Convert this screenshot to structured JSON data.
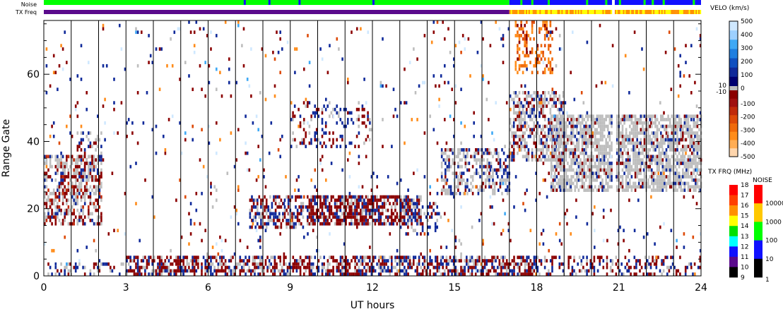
{
  "chart_data": {
    "type": "heatmap",
    "xlabel": "UT hours",
    "ylabel": "Range Gate",
    "xlim": [
      0,
      24
    ],
    "ylim": [
      0,
      76
    ],
    "xticks": [
      "0",
      "3",
      "6",
      "9",
      "12",
      "15",
      "18",
      "21",
      "24"
    ],
    "yticks": [
      "0",
      "20",
      "40",
      "60"
    ],
    "ground_scatter_color": "#bebebe",
    "data_gap_hours": [
      20.75,
      20.85
    ],
    "echo_regions": [
      {
        "t": [
          0,
          2.1
        ],
        "g": [
          15,
          36
        ],
        "density": 0.55,
        "mix": {
          "gs": 0.5,
          "-50": 0.3,
          "50": 0.1,
          "-150": 0.1
        }
      },
      {
        "t": [
          1.2,
          2.1
        ],
        "g": [
          28,
          43
        ],
        "density": 0.4,
        "mix": {
          "gs": 0.5,
          "-50": 0.3,
          "50": 0.2
        }
      },
      {
        "t": [
          0,
          3
        ],
        "g": [
          0,
          4
        ],
        "density": 0.25,
        "mix": {
          "50": 0.4,
          "-50": 0.3,
          "gs": 0.3
        }
      },
      {
        "t": [
          3,
          18
        ],
        "g": [
          0,
          6
        ],
        "density": 0.6,
        "mix": {
          "-50": 0.5,
          "50": 0.3,
          "gs": 0.2
        }
      },
      {
        "t": [
          18,
          24
        ],
        "g": [
          0,
          6
        ],
        "density": 0.3,
        "mix": {
          "-50": 0.45,
          "50": 0.35,
          "gs": 0.2
        }
      },
      {
        "t": [
          7.5,
          9.5
        ],
        "g": [
          14,
          24
        ],
        "density": 0.55,
        "mix": {
          "-50": 0.45,
          "50": 0.35,
          "gs": 0.2
        }
      },
      {
        "t": [
          9.6,
          13.8
        ],
        "g": [
          15,
          24
        ],
        "density": 0.75,
        "mix": {
          "-50": 0.65,
          "50": 0.2,
          "gs": 0.15
        }
      },
      {
        "t": [
          13,
          14.5
        ],
        "g": [
          12,
          22
        ],
        "density": 0.3,
        "mix": {
          "50": 0.5,
          "-50": 0.3,
          "gs": 0.2
        }
      },
      {
        "t": [
          9,
          12
        ],
        "g": [
          38,
          52
        ],
        "density": 0.18,
        "mix": {
          "-50": 0.4,
          "50": 0.4,
          "gs": 0.2
        }
      },
      {
        "t": [
          14.5,
          17
        ],
        "g": [
          24,
          38
        ],
        "density": 0.5,
        "mix": {
          "gs": 0.55,
          "50": 0.3,
          "-50": 0.15
        }
      },
      {
        "t": [
          17,
          19
        ],
        "g": [
          34,
          55
        ],
        "density": 0.55,
        "mix": {
          "gs": 0.6,
          "50": 0.2,
          "-50": 0.2
        }
      },
      {
        "t": [
          18.5,
          24
        ],
        "g": [
          25,
          48
        ],
        "density": 0.7,
        "mix": {
          "gs": 0.8,
          "50": 0.1,
          "-50": 0.1
        }
      },
      {
        "t": [
          17.2,
          18.6
        ],
        "g": [
          60,
          76
        ],
        "density": 0.35,
        "mix": {
          "-350": 0.4,
          "-450": 0.3,
          "-250": 0.2,
          "-50": 0.1
        }
      },
      {
        "t": [
          0,
          24
        ],
        "g": [
          0,
          76
        ],
        "density": 0.025,
        "mix": {
          "-50": 0.3,
          "50": 0.3,
          "-450": 0.12,
          "450": 0.12,
          "gs": 0.08,
          "250": 0.04,
          "-250": 0.04
        }
      }
    ],
    "noise_bar": [
      {
        "t": [
          0,
          17
        ],
        "level": "100"
      },
      {
        "t": [
          17,
          20.75
        ],
        "level": "10"
      },
      {
        "t": [
          20.85,
          24
        ],
        "level": "10"
      }
    ],
    "noise_green_patches": [
      7.3,
      8.2,
      9.3,
      12.0,
      17.4,
      17.8,
      18.4,
      19.8,
      20.5,
      21.0,
      21.9,
      22.2,
      22.6,
      23.7
    ],
    "txfreq_bar": [
      {
        "t": [
          0,
          17
        ],
        "mhz": 10
      },
      {
        "t": [
          17,
          20.75
        ],
        "mhz": 15
      },
      {
        "t": [
          20.85,
          24
        ],
        "mhz": 14
      }
    ]
  },
  "header": {
    "noise_label": "Noise",
    "txfreq_label": "TX Freq"
  },
  "velocity_colorbar": {
    "title": "VELO (km/s)",
    "labels": [
      "500",
      "400",
      "300",
      "200",
      "100",
      "0",
      "-100",
      "-200",
      "-300",
      "-400",
      "-500"
    ],
    "inner_labels": [
      "10",
      "-10"
    ],
    "colors_top_to_bottom": [
      "#cfe8ff",
      "#9dd0ff",
      "#3fa9f5",
      "#1f7fe0",
      "#1050c0",
      "#102a9a",
      "#000070",
      "#8b0000",
      "#a01010",
      "#c02a0a",
      "#dd4a08",
      "#f06a0a",
      "#ff8c1a",
      "#ffad55",
      "#ffd6ad"
    ]
  },
  "txfreq_colorbar": {
    "title": "TX FRQ (MHz)",
    "labels": [
      "18",
      "17",
      "16",
      "15",
      "14",
      "13",
      "12",
      "11",
      "10",
      "9"
    ],
    "colors_top_to_bottom": [
      "#ff0000",
      "#ff4000",
      "#ff9000",
      "#ffff00",
      "#00e000",
      "#00ffff",
      "#1010ff",
      "#5a0a8c",
      "#000000"
    ]
  },
  "noise_colorbar": {
    "title": "NOISE",
    "labels": [
      "10000",
      "1000",
      "100",
      "10",
      "1"
    ],
    "colors_top_to_bottom": [
      "#ff0000",
      "#ffc800",
      "#00ff00",
      "#1010ff",
      "#000000"
    ]
  }
}
